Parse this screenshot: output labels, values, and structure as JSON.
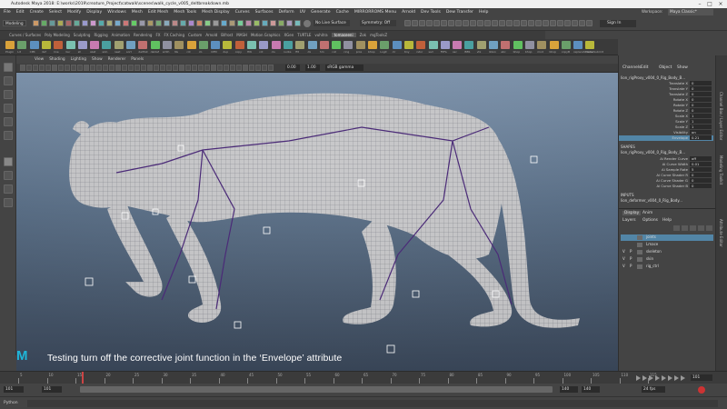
{
  "window": {
    "title": "Autodesk Maya 2018: E:\\works\\2019\\creature_Project\\catwalk\\scenes\\walk_cycle_v005_deltbreakdown.mb",
    "workspace_label": "Workspace:",
    "workspace_value": "Maya Classic*"
  },
  "menubar": [
    "File",
    "Edit",
    "Create",
    "Select",
    "Modify",
    "Display",
    "Windows",
    "Mesh",
    "Edit Mesh",
    "Mesh Tools",
    "Mesh Display",
    "Curves",
    "Surfaces",
    "Deform",
    "UV",
    "Generate",
    "Cache",
    "MIRRORROMS Menu",
    "Arnold",
    "Dev Tools",
    "Dew Transfer",
    "Help"
  ],
  "status": {
    "mode": "Modeling",
    "live_surface": "No Live Surface",
    "symmetry": "Symmetry: Off",
    "sign_in": "Sign In"
  },
  "shelf": {
    "tabs": [
      "Curves / Surfaces",
      "Poly Modeling",
      "Sculpting",
      "Rigging",
      "Animation",
      "Rendering",
      "FX",
      "FX Caching",
      "Custom",
      "Arnold",
      "Bifrost",
      "MASH",
      "Motion Graphics",
      "XGen",
      "TURTLE",
      "vuhitra",
      "tomaseeni",
      "Zok",
      "mgToolsZ"
    ],
    "active_tab": "tomaseeni",
    "icons": [
      "Plugin",
      "Lit",
      "CPR",
      "def",
      "line",
      "bur",
      "sh",
      "skat",
      "skin",
      "neet",
      "sort",
      "delHist",
      "deldef",
      "smth",
      "Ns",
      "rot",
      "cb",
      "CPM",
      "dup",
      "copy",
      "HIK",
      "rot",
      "cls",
      "nurbs",
      "ffd",
      "dx",
      "hm",
      "cut",
      "ring",
      "prox",
      "bhop",
      "Logit",
      "clr",
      "tiny",
      "rstor",
      "ssd",
      "FitFa",
      "ssc",
      "BBS",
      "vtx",
      "lkkon",
      "abc",
      "bhop",
      "bhop",
      "mod",
      "bhop",
      "copyB",
      "replaceShader",
      "NameSubmit"
    ]
  },
  "panel_menu": [
    "View",
    "Shading",
    "Lighting",
    "Show",
    "Renderer",
    "Panels"
  ],
  "viewport": {
    "gamma_label": "sRGB gamma",
    "exposure": "0.00",
    "gamma": "1.00"
  },
  "caption": "Testing turn off the corrective joint function in the ‘Envelope’ attribute",
  "channel_box": {
    "tabs": [
      "Channels",
      "Edit",
      "Object",
      "Show"
    ],
    "node": "lion_rigProxy_v004_0_Rig_Body_B...",
    "attributes": [
      {
        "name": "Translate X",
        "value": "0"
      },
      {
        "name": "Translate Y",
        "value": "0"
      },
      {
        "name": "Translate Z",
        "value": "0"
      },
      {
        "name": "Rotate X",
        "value": "0"
      },
      {
        "name": "Rotate Y",
        "value": "0"
      },
      {
        "name": "Rotate Z",
        "value": "0"
      },
      {
        "name": "Scale X",
        "value": "1"
      },
      {
        "name": "Scale Y",
        "value": "1"
      },
      {
        "name": "Scale Z",
        "value": "1"
      },
      {
        "name": "Visibility",
        "value": "on"
      },
      {
        "name": "Envelope",
        "value": "0.21"
      }
    ],
    "shapes_header": "SHAPES",
    "shape_node": "lion_rigProxy_v004_0_Rig_Body_B...",
    "shape_attrs": [
      {
        "name": "Ai Render Curve",
        "value": "off"
      },
      {
        "name": "Ai Curve Width",
        "value": "0.01"
      },
      {
        "name": "Ai Sample Rate",
        "value": "5"
      },
      {
        "name": "Ai Curve Shader R",
        "value": "0"
      },
      {
        "name": "Ai Curve Shader G",
        "value": "0"
      },
      {
        "name": "Ai Curve Shader B",
        "value": "0"
      }
    ],
    "inputs_header": "INPUTS",
    "input_node": "lion_deformer_v004_0_Rig_Body..."
  },
  "vertical_tabs": [
    "Channel Box / Layer Editor",
    "Modeling Toolkit",
    "Attribute Editor"
  ],
  "layer_editor": {
    "tabs": [
      "Display",
      "Anim"
    ],
    "menu": [
      "Layers",
      "Options",
      "Help"
    ],
    "layers": [
      {
        "v": "",
        "p": "",
        "name": "joints"
      },
      {
        "v": "",
        "p": "",
        "name": "Lmace"
      },
      {
        "v": "V",
        "p": "P",
        "name": "skeleton"
      },
      {
        "v": "V",
        "p": "P",
        "name": "skin"
      },
      {
        "v": "V",
        "p": "P",
        "name": "rig_ctrl"
      }
    ]
  },
  "timeline": {
    "ticks": [
      "5",
      "10",
      "15",
      "20",
      "25",
      "30",
      "35",
      "40",
      "45",
      "50",
      "55",
      "60",
      "65",
      "70",
      "75",
      "80",
      "85",
      "90",
      "95",
      "100",
      "105",
      "110",
      "115"
    ],
    "current_frame": "101",
    "start": "101",
    "range_start": "101",
    "range_end": "140",
    "end": "140",
    "anim_end": "200",
    "fps": "24 fps",
    "char_set": "No Character Set",
    "anim_layer": "No Anim Layer"
  },
  "command_line": {
    "language": "Python"
  },
  "colors": {
    "accent": "#1fb6d8",
    "selection": "#5285a6",
    "mesh": "#c8c8c8",
    "joint": "#4b2b78"
  }
}
